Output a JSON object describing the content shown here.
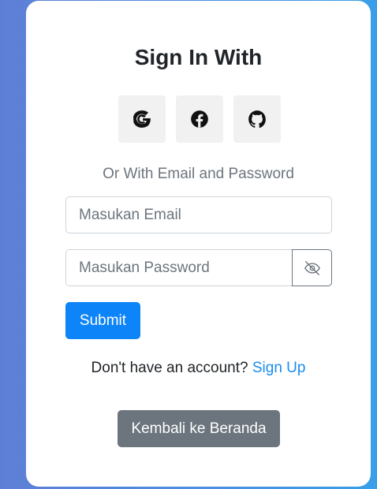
{
  "heading": "Sign In With",
  "social": {
    "google_icon": "google-icon",
    "facebook_icon": "facebook-icon",
    "github_icon": "github-icon"
  },
  "divider_text": "Or With Email and Password",
  "form": {
    "email_placeholder": "Masukan Email",
    "email_value": "",
    "password_placeholder": "Masukan Password",
    "password_value": "",
    "toggle_icon": "eye-slash-icon",
    "submit_label": "Submit"
  },
  "account": {
    "prompt": "Don't have an account?",
    "signup_label": "Sign Up"
  },
  "back_label": "Kembali ke Beranda",
  "colors": {
    "primary": "#0d84f7",
    "secondary": "#6c757d",
    "link": "#1a8cf0",
    "background_gradient_start": "#5f7fd6",
    "background_gradient_end": "#3a9fe8"
  }
}
